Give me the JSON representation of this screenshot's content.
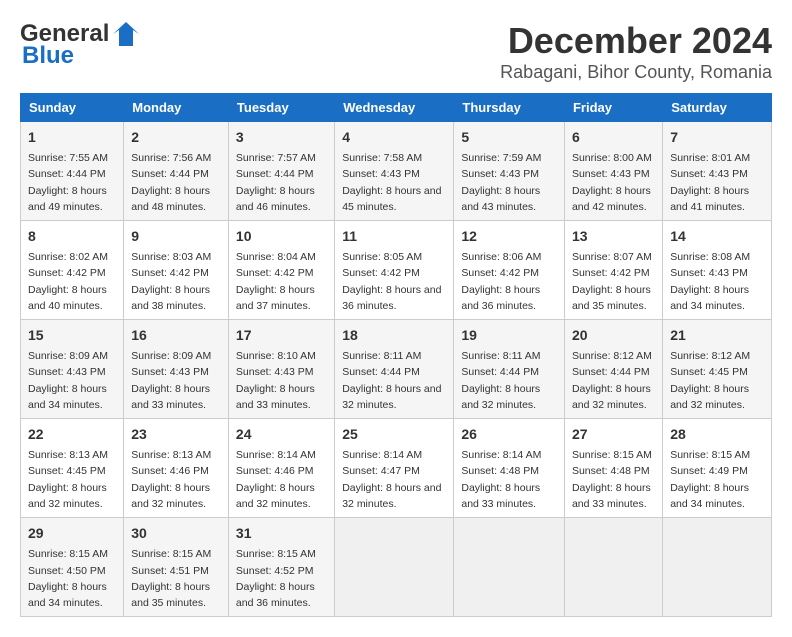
{
  "header": {
    "logo_line1": "General",
    "logo_line2": "Blue",
    "title": "December 2024",
    "subtitle": "Rabagani, Bihor County, Romania"
  },
  "days_of_week": [
    "Sunday",
    "Monday",
    "Tuesday",
    "Wednesday",
    "Thursday",
    "Friday",
    "Saturday"
  ],
  "weeks": [
    [
      {
        "day": "1",
        "info": "Sunrise: 7:55 AM\nSunset: 4:44 PM\nDaylight: 8 hours and 49 minutes."
      },
      {
        "day": "2",
        "info": "Sunrise: 7:56 AM\nSunset: 4:44 PM\nDaylight: 8 hours and 48 minutes."
      },
      {
        "day": "3",
        "info": "Sunrise: 7:57 AM\nSunset: 4:44 PM\nDaylight: 8 hours and 46 minutes."
      },
      {
        "day": "4",
        "info": "Sunrise: 7:58 AM\nSunset: 4:43 PM\nDaylight: 8 hours and 45 minutes."
      },
      {
        "day": "5",
        "info": "Sunrise: 7:59 AM\nSunset: 4:43 PM\nDaylight: 8 hours and 43 minutes."
      },
      {
        "day": "6",
        "info": "Sunrise: 8:00 AM\nSunset: 4:43 PM\nDaylight: 8 hours and 42 minutes."
      },
      {
        "day": "7",
        "info": "Sunrise: 8:01 AM\nSunset: 4:43 PM\nDaylight: 8 hours and 41 minutes."
      }
    ],
    [
      {
        "day": "8",
        "info": "Sunrise: 8:02 AM\nSunset: 4:42 PM\nDaylight: 8 hours and 40 minutes."
      },
      {
        "day": "9",
        "info": "Sunrise: 8:03 AM\nSunset: 4:42 PM\nDaylight: 8 hours and 38 minutes."
      },
      {
        "day": "10",
        "info": "Sunrise: 8:04 AM\nSunset: 4:42 PM\nDaylight: 8 hours and 37 minutes."
      },
      {
        "day": "11",
        "info": "Sunrise: 8:05 AM\nSunset: 4:42 PM\nDaylight: 8 hours and 36 minutes."
      },
      {
        "day": "12",
        "info": "Sunrise: 8:06 AM\nSunset: 4:42 PM\nDaylight: 8 hours and 36 minutes."
      },
      {
        "day": "13",
        "info": "Sunrise: 8:07 AM\nSunset: 4:42 PM\nDaylight: 8 hours and 35 minutes."
      },
      {
        "day": "14",
        "info": "Sunrise: 8:08 AM\nSunset: 4:43 PM\nDaylight: 8 hours and 34 minutes."
      }
    ],
    [
      {
        "day": "15",
        "info": "Sunrise: 8:09 AM\nSunset: 4:43 PM\nDaylight: 8 hours and 34 minutes."
      },
      {
        "day": "16",
        "info": "Sunrise: 8:09 AM\nSunset: 4:43 PM\nDaylight: 8 hours and 33 minutes."
      },
      {
        "day": "17",
        "info": "Sunrise: 8:10 AM\nSunset: 4:43 PM\nDaylight: 8 hours and 33 minutes."
      },
      {
        "day": "18",
        "info": "Sunrise: 8:11 AM\nSunset: 4:44 PM\nDaylight: 8 hours and 32 minutes."
      },
      {
        "day": "19",
        "info": "Sunrise: 8:11 AM\nSunset: 4:44 PM\nDaylight: 8 hours and 32 minutes."
      },
      {
        "day": "20",
        "info": "Sunrise: 8:12 AM\nSunset: 4:44 PM\nDaylight: 8 hours and 32 minutes."
      },
      {
        "day": "21",
        "info": "Sunrise: 8:12 AM\nSunset: 4:45 PM\nDaylight: 8 hours and 32 minutes."
      }
    ],
    [
      {
        "day": "22",
        "info": "Sunrise: 8:13 AM\nSunset: 4:45 PM\nDaylight: 8 hours and 32 minutes."
      },
      {
        "day": "23",
        "info": "Sunrise: 8:13 AM\nSunset: 4:46 PM\nDaylight: 8 hours and 32 minutes."
      },
      {
        "day": "24",
        "info": "Sunrise: 8:14 AM\nSunset: 4:46 PM\nDaylight: 8 hours and 32 minutes."
      },
      {
        "day": "25",
        "info": "Sunrise: 8:14 AM\nSunset: 4:47 PM\nDaylight: 8 hours and 32 minutes."
      },
      {
        "day": "26",
        "info": "Sunrise: 8:14 AM\nSunset: 4:48 PM\nDaylight: 8 hours and 33 minutes."
      },
      {
        "day": "27",
        "info": "Sunrise: 8:15 AM\nSunset: 4:48 PM\nDaylight: 8 hours and 33 minutes."
      },
      {
        "day": "28",
        "info": "Sunrise: 8:15 AM\nSunset: 4:49 PM\nDaylight: 8 hours and 34 minutes."
      }
    ],
    [
      {
        "day": "29",
        "info": "Sunrise: 8:15 AM\nSunset: 4:50 PM\nDaylight: 8 hours and 34 minutes."
      },
      {
        "day": "30",
        "info": "Sunrise: 8:15 AM\nSunset: 4:51 PM\nDaylight: 8 hours and 35 minutes."
      },
      {
        "day": "31",
        "info": "Sunrise: 8:15 AM\nSunset: 4:52 PM\nDaylight: 8 hours and 36 minutes."
      },
      {
        "day": "",
        "info": ""
      },
      {
        "day": "",
        "info": ""
      },
      {
        "day": "",
        "info": ""
      },
      {
        "day": "",
        "info": ""
      }
    ]
  ]
}
